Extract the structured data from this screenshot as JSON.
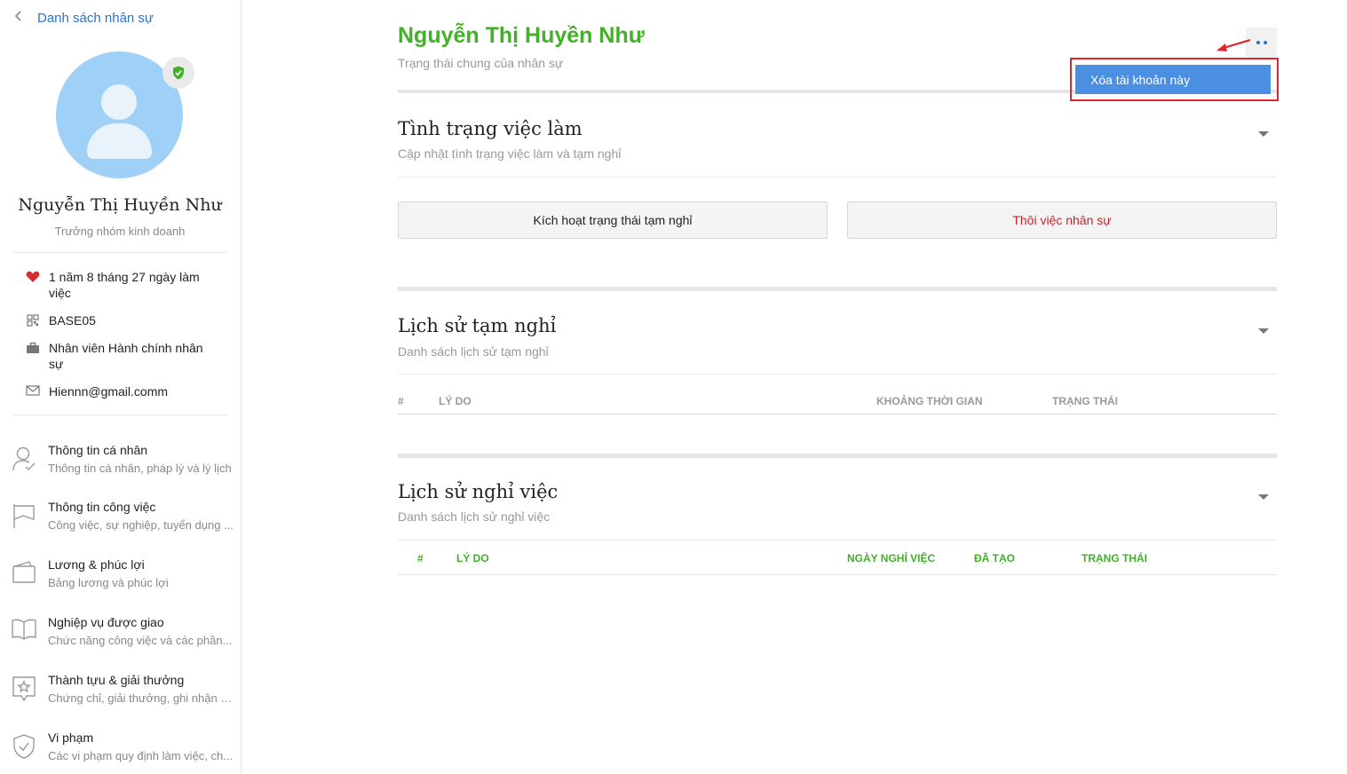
{
  "sidebar": {
    "back_label": "Danh sách nhân sự",
    "profile": {
      "name": "Nguyễn Thị Huyền Như",
      "role": "Trưởng nhóm kinh doanh"
    },
    "info": [
      {
        "icon": "heart-icon",
        "text": "1 năm 8 tháng 27 ngày làm việc"
      },
      {
        "icon": "qr-code-icon",
        "text": "BASE05"
      },
      {
        "icon": "briefcase-icon",
        "text": "Nhân viên Hành chính nhân sự"
      },
      {
        "icon": "mail-icon",
        "text": "Hiennn@gmail.comm"
      }
    ],
    "menu": [
      {
        "icon": "user-icon",
        "title": "Thông tin cá nhân",
        "subtitle": "Thông tin cá nhân, pháp lý và lý lịch"
      },
      {
        "icon": "flag-icon",
        "title": "Thông tin công việc",
        "subtitle": "Công việc, sự nghiệp, tuyển dụng ..."
      },
      {
        "icon": "wallet-icon",
        "title": "Lương & phúc lợi",
        "subtitle": "Bảng lương và phúc lợi"
      },
      {
        "icon": "book-icon",
        "title": "Nghiệp vụ được giao",
        "subtitle": "Chức năng công việc và các phần..."
      },
      {
        "icon": "award-icon",
        "title": "Thành tựu & giải thưởng",
        "subtitle": "Chứng chỉ, giải thưởng, ghi nhận v..."
      },
      {
        "icon": "shield-icon",
        "title": "Vi phạm",
        "subtitle": "Các vi phạm quy định làm việc, ch..."
      }
    ]
  },
  "header": {
    "title": "Nguyễn Thị Huyền Như",
    "subtitle": "Trạng thái chung của nhân sự",
    "more_menu": {
      "item_label": "Xóa tài khoản này"
    }
  },
  "sections": {
    "employment": {
      "title": "Tình trạng việc làm",
      "subtitle": "Cập nhật tình trạng việc làm và tạm nghỉ",
      "activate_leave_label": "Kích hoạt trạng thái tạm nghỉ",
      "terminate_label": "Thôi việc nhân sự"
    },
    "leave_history": {
      "title": "Lịch sử tạm nghỉ",
      "subtitle": "Danh sách lịch sử tạm nghỉ",
      "columns": [
        "#",
        "LÝ DO",
        "KHOẢNG THỜI GIAN",
        "TRẠNG THÁI"
      ]
    },
    "termination_history": {
      "title": "Lịch sử nghỉ việc",
      "subtitle": "Danh sách lịch sử nghỉ việc",
      "columns": [
        "#",
        "LÝ DO",
        "NGÀY NGHỈ VIỆC",
        "ĐÃ TẠO",
        "TRẠNG THÁI"
      ]
    }
  },
  "colors": {
    "accent_green": "#43b02a",
    "link_blue": "#2a74c9",
    "danger_red": "#c0272d",
    "highlight_outline": "#e3242b",
    "menu_item_blue": "#4a8fe2"
  }
}
